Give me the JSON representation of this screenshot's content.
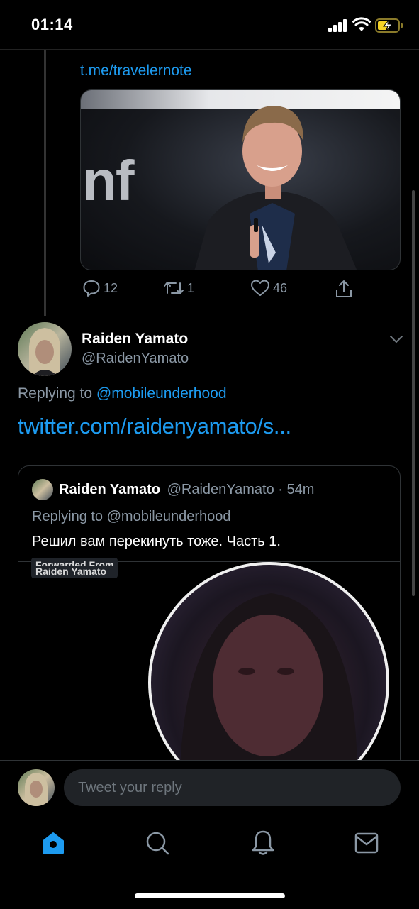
{
  "status": {
    "time": "01:14"
  },
  "tweet_top": {
    "link": "t.me/travelernote",
    "media_text": "nf",
    "actions": {
      "replies": "12",
      "retweets": "1",
      "likes": "46"
    }
  },
  "main_tweet": {
    "name": "Raiden Yamato",
    "handle": "@RaidenYamato",
    "replying_prefix": "Replying to",
    "replying_handle": "@mobileunderhood",
    "link": "twitter.com/raidenyamato/s..."
  },
  "quoted_tweet": {
    "name": "Raiden Yamato",
    "handle_time": "@RaidenYamato · 54m",
    "replying": "Replying to @mobileunderhood",
    "text": "Решил вам перекинуть тоже. Часть 1.",
    "media_overlay_line1": "Forwarded From",
    "media_overlay_line2": "Raiden Yamato"
  },
  "reply_box": {
    "placeholder": "Tweet your reply"
  },
  "colors": {
    "accent": "#1d9bf0",
    "muted": "#8b98a5",
    "background": "#000000"
  },
  "icons": [
    "signal-icon",
    "wifi-icon",
    "battery-icon",
    "reply-icon",
    "retweet-icon",
    "like-icon",
    "share-icon",
    "chevron-down-icon",
    "home-icon",
    "search-icon",
    "notifications-icon",
    "messages-icon"
  ]
}
